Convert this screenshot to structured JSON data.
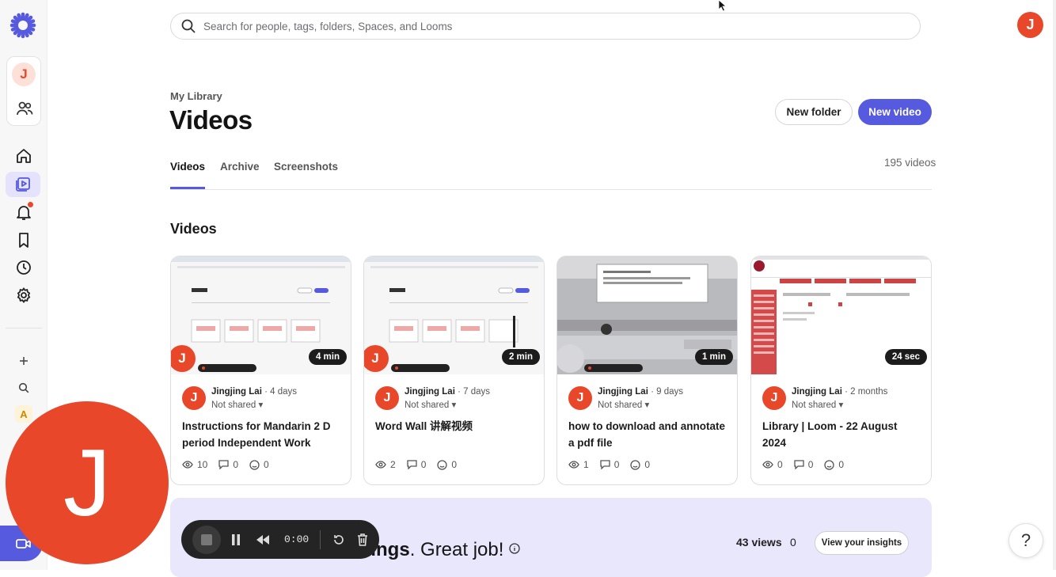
{
  "search": {
    "placeholder": "Search for people, tags, folders, Spaces, and Looms"
  },
  "user": {
    "initial": "J"
  },
  "sidebar": {
    "space_initial": "A",
    "items": [
      {
        "name": "home-icon"
      },
      {
        "name": "library-icon",
        "active": true
      },
      {
        "name": "bell-icon",
        "badge": true
      },
      {
        "name": "bookmark-icon"
      },
      {
        "name": "clock-icon"
      },
      {
        "name": "gear-icon"
      }
    ],
    "accent": "#565adf"
  },
  "header": {
    "breadcrumb": "My Library",
    "title": "Videos",
    "new_folder_label": "New folder",
    "new_video_label": "New video"
  },
  "tabs": [
    {
      "label": "Videos",
      "active": true
    },
    {
      "label": "Archive"
    },
    {
      "label": "Screenshots"
    }
  ],
  "video_count": "195 videos",
  "section_title": "Videos",
  "videos": [
    {
      "owner": "Jingjing Lai",
      "age": "4 days",
      "share": "Not shared",
      "title": "Instructions for Mandarin 2 D period Independent Work",
      "duration": "4 min",
      "views": "10",
      "comments": "0",
      "reactions": "0"
    },
    {
      "owner": "Jingjing Lai",
      "age": "7 days",
      "share": "Not shared",
      "title": "Word Wall 讲解视频",
      "duration": "2 min",
      "views": "2",
      "comments": "0",
      "reactions": "0"
    },
    {
      "owner": "Jingjing Lai",
      "age": "9 days",
      "share": "Not shared",
      "title": "how to download and annotate a pdf file",
      "duration": "1 min",
      "views": "1",
      "comments": "0",
      "reactions": "0"
    },
    {
      "owner": "Jingjing Lai",
      "age": "2 months",
      "share": "Not shared",
      "title": "Library | Loom - 22 August 2024",
      "duration": "24 sec",
      "views": "0",
      "comments": "0",
      "reactions": "0"
    }
  ],
  "insights": {
    "bold_text": "etings",
    "rest_text": ". Great job!",
    "views_label": "43 views",
    "second_value": "0",
    "button_label": "View your insights"
  },
  "recorder": {
    "time": "0:00",
    "camera_initial": "J"
  },
  "help_label": "?",
  "colors": {
    "brand_orange": "#e8472a",
    "accent_purple": "#565adf",
    "banner_bg": "#e8e7fb"
  }
}
